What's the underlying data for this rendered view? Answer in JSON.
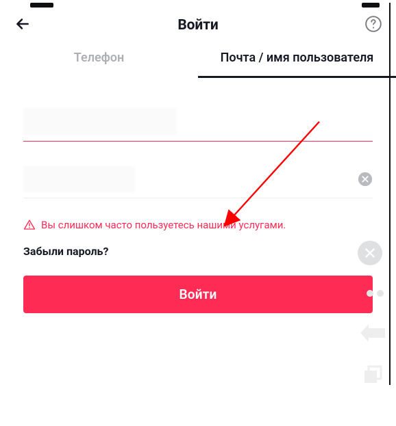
{
  "header": {
    "title": "Войти"
  },
  "tabs": {
    "phone": "Телефон",
    "email": "Почта / имя пользователя"
  },
  "error": {
    "message": "Вы слишком часто пользуетесь нашими услугами."
  },
  "forgot": {
    "label": "Забыли пароль?"
  },
  "login": {
    "button": "Войти"
  },
  "colors": {
    "accent": "#fe2c55",
    "text": "#161823",
    "muted": "#aeafb4"
  }
}
